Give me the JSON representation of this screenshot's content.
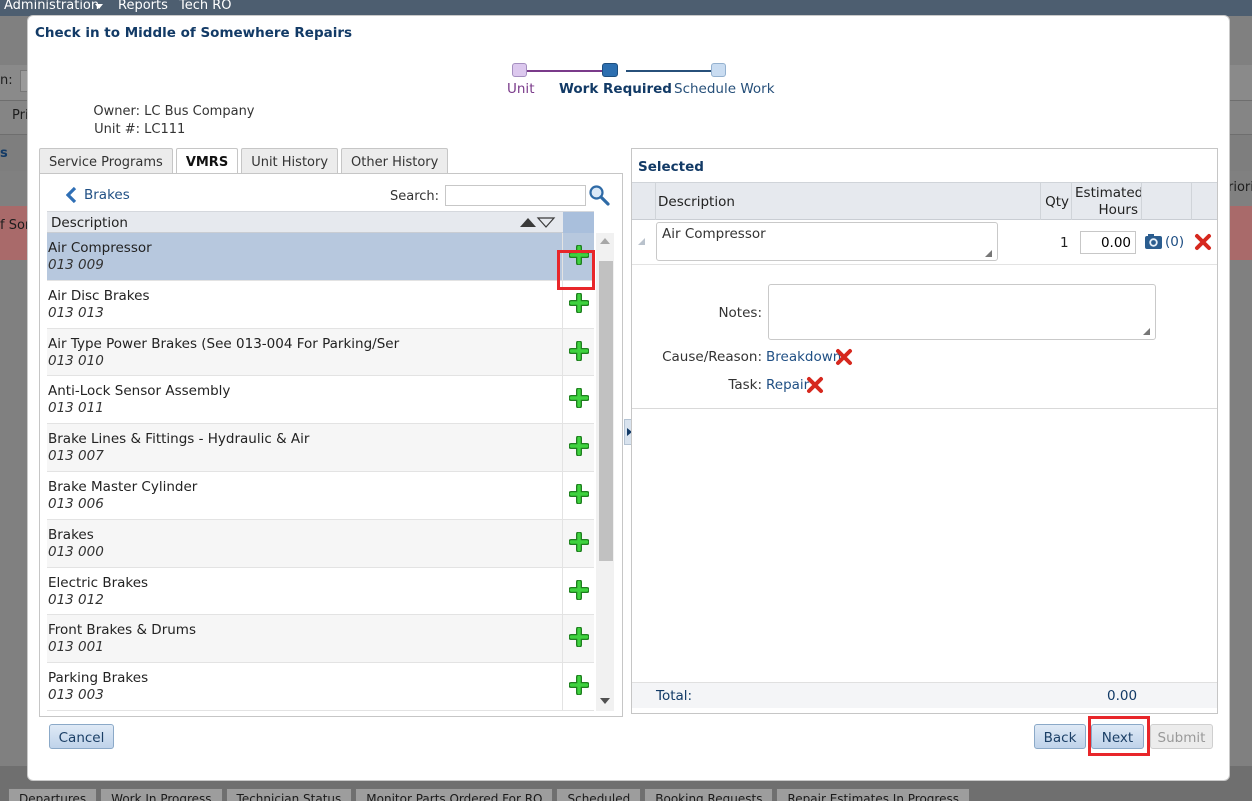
{
  "background": {
    "menu": [
      "Administration",
      "Reports",
      "Tech RO"
    ],
    "fragments": {
      "left1": "n:",
      "left2": "Pri",
      "left3": "s",
      "left4": "f Son",
      "right1": "riori"
    },
    "bottom_tabs": [
      "Departures",
      "Work In Progress",
      "Technician Status",
      "Monitor Parts Ordered For RO",
      "Scheduled",
      "Booking Requests",
      "Repair Estimates In Progress"
    ]
  },
  "dialog": {
    "title": "Check in to Middle of Somewhere Repairs",
    "steps": [
      {
        "label": "Unit",
        "state": "done"
      },
      {
        "label": "Work Required",
        "state": "current"
      },
      {
        "label": "Schedule Work",
        "state": "todo"
      }
    ],
    "owner_label": "Owner:",
    "owner_value": "LC Bus Company",
    "unit_label": "Unit #:",
    "unit_value": "LC111"
  },
  "left_tabs": [
    "Service Programs",
    "VMRS",
    "Unit History",
    "Other History"
  ],
  "active_tab": "VMRS",
  "vmrs": {
    "back_label": "Brakes",
    "search_label": "Search:",
    "search_value": "",
    "column_description": "Description",
    "items": [
      {
        "name": "Air Compressor",
        "code": "013 009"
      },
      {
        "name": "Air Disc Brakes",
        "code": "013 013"
      },
      {
        "name": "Air Type Power Brakes (See 013-004 For Parking/Ser",
        "code": "013 010"
      },
      {
        "name": "Anti-Lock Sensor Assembly",
        "code": "013 011"
      },
      {
        "name": "Brake Lines & Fittings - Hydraulic & Air",
        "code": "013 007"
      },
      {
        "name": "Brake Master Cylinder",
        "code": "013 006"
      },
      {
        "name": "Brakes",
        "code": "013 000"
      },
      {
        "name": "Electric Brakes",
        "code": "013 012"
      },
      {
        "name": "Front Brakes & Drums",
        "code": "013 001"
      },
      {
        "name": "Parking Brakes",
        "code": "013 003"
      }
    ]
  },
  "selected": {
    "title": "Selected",
    "col_description": "Description",
    "col_qty": "Qty",
    "col_hours_1": "Estimated",
    "col_hours_2": "Hours",
    "item": {
      "description": "Air Compressor",
      "qty": "1",
      "hours": "0.00",
      "photo_count": "(0)"
    },
    "notes_label": "Notes:",
    "cause_label": "Cause/Reason:",
    "cause_value": "Breakdown",
    "task_label": "Task:",
    "task_value": "Repair",
    "total_label": "Total:",
    "total_value": "0.00"
  },
  "buttons": {
    "cancel": "Cancel",
    "back": "Back",
    "next": "Next",
    "submit": "Submit"
  },
  "colors": {
    "accent": "#123a66",
    "link": "#1f4f84",
    "highlight": "#e8262a",
    "add": "#2db52d",
    "delete": "#d6281e"
  }
}
